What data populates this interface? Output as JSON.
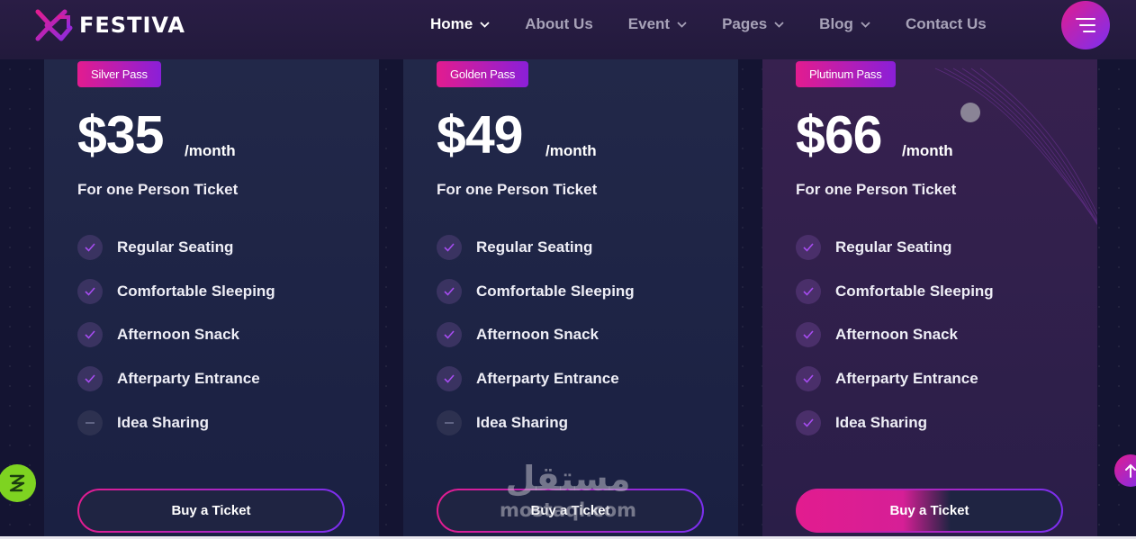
{
  "brand": {
    "name": "FESTIVA"
  },
  "nav": {
    "items": [
      {
        "label": "Home",
        "has_dropdown": true,
        "active": true
      },
      {
        "label": "About Us",
        "has_dropdown": false,
        "active": false
      },
      {
        "label": "Event",
        "has_dropdown": true,
        "active": false
      },
      {
        "label": "Pages",
        "has_dropdown": true,
        "active": false
      },
      {
        "label": "Blog",
        "has_dropdown": true,
        "active": false
      },
      {
        "label": "Contact Us",
        "has_dropdown": false,
        "active": false
      }
    ],
    "menu_icon": "hamburger-menu-icon"
  },
  "plans": [
    {
      "badge": "Silver Pass",
      "price": "$35",
      "period": "/month",
      "subtitle": "For one Person Ticket",
      "features": [
        {
          "label": "Regular Seating",
          "included": true
        },
        {
          "label": "Comfortable Sleeping",
          "included": true
        },
        {
          "label": "Afternoon Snack",
          "included": true
        },
        {
          "label": "Afterparty Entrance",
          "included": true
        },
        {
          "label": "Idea Sharing",
          "included": false
        }
      ],
      "button": "Buy a Ticket"
    },
    {
      "badge": "Golden Pass",
      "price": "$49",
      "period": "/month",
      "subtitle": "For one Person Ticket",
      "features": [
        {
          "label": "Regular Seating",
          "included": true
        },
        {
          "label": "Comfortable Sleeping",
          "included": true
        },
        {
          "label": "Afternoon Snack",
          "included": true
        },
        {
          "label": "Afterparty Entrance",
          "included": true
        },
        {
          "label": "Idea Sharing",
          "included": false
        }
      ],
      "button": "Buy a Ticket"
    },
    {
      "badge": "Plutinum Pass",
      "price": "$66",
      "period": "/month",
      "subtitle": "For one Person Ticket",
      "features": [
        {
          "label": "Regular Seating",
          "included": true
        },
        {
          "label": "Comfortable Sleeping",
          "included": true
        },
        {
          "label": "Afternoon Snack",
          "included": true
        },
        {
          "label": "Afterparty Entrance",
          "included": true
        },
        {
          "label": "Idea Sharing",
          "included": true
        }
      ],
      "button": "Buy a Ticket"
    }
  ],
  "watermark": {
    "arabic": "مستقل",
    "latin": "mostaql.com"
  },
  "colors": {
    "accent_pink": "#e21c8f",
    "accent_purple": "#7b2ff0",
    "page_bg": "#141432",
    "card_bg": "#222849",
    "featured_card_bg": "#37214f",
    "check": "#a64cf0"
  },
  "icons": {
    "check": "check-icon",
    "dash": "dash-icon",
    "scroll_top": "arrow-up-icon",
    "side_widget": "lightning-icon"
  }
}
